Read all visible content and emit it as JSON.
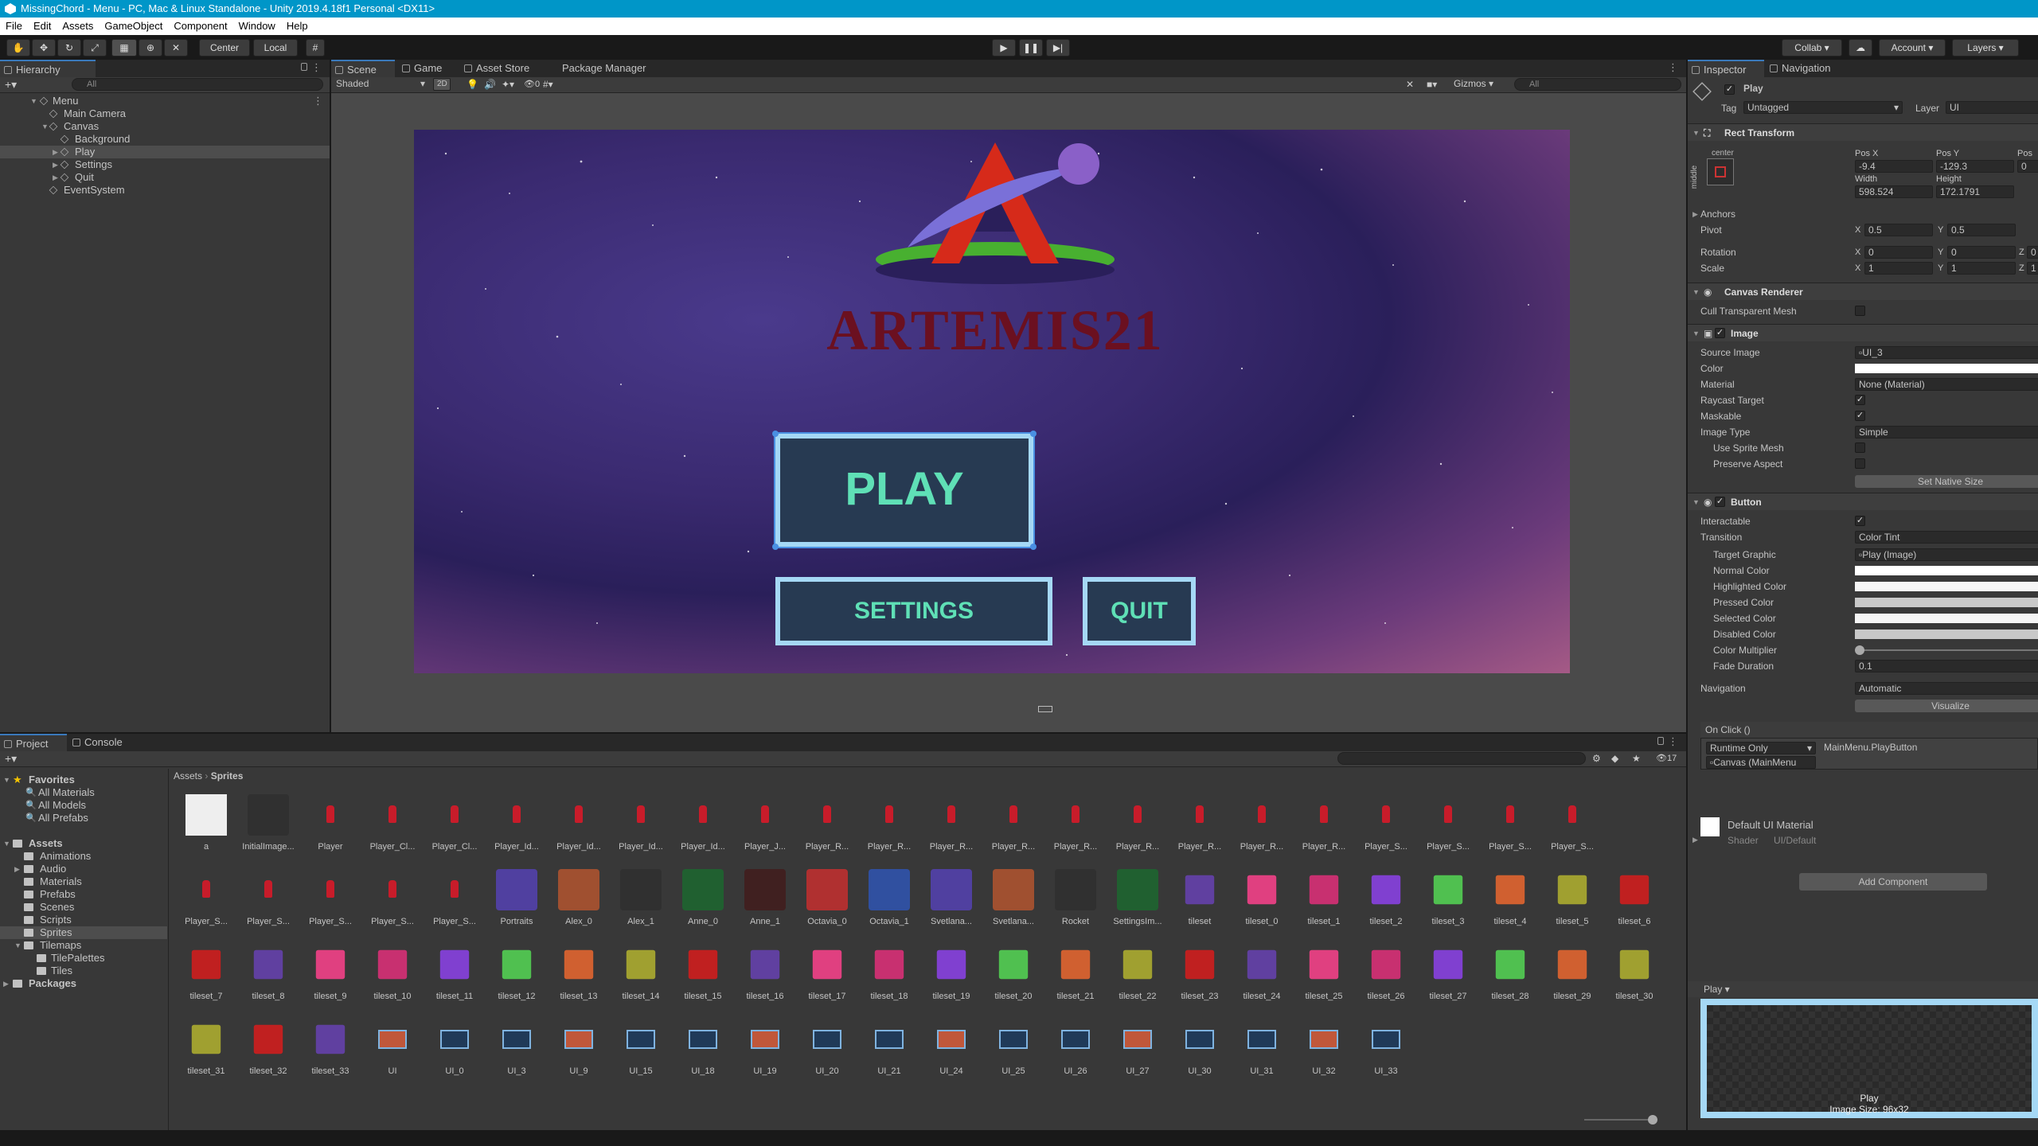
{
  "window": {
    "title": "MissingChord - Menu - PC, Mac & Linux Standalone - Unity 2019.4.18f1 Personal <DX11>"
  },
  "menubar": {
    "items": [
      "File",
      "Edit",
      "Assets",
      "GameObject",
      "Component",
      "Window",
      "Help"
    ]
  },
  "toolbar": {
    "pivot": "Center",
    "space": "Local",
    "collab": "Collab",
    "account": "Account",
    "layers": "Layers"
  },
  "hierarchy": {
    "tab": "Hierarchy",
    "search": "All",
    "items": [
      {
        "label": "Menu",
        "depth": 0,
        "selected": false
      },
      {
        "label": "Main Camera",
        "depth": 1,
        "selected": false
      },
      {
        "label": "Canvas",
        "depth": 1,
        "selected": false
      },
      {
        "label": "Background",
        "depth": 2,
        "selected": false
      },
      {
        "label": "Play",
        "depth": 2,
        "selected": true
      },
      {
        "label": "Settings",
        "depth": 2,
        "selected": false
      },
      {
        "label": "Quit",
        "depth": 2,
        "selected": false
      },
      {
        "label": "EventSystem",
        "depth": 1,
        "selected": false
      }
    ]
  },
  "scene": {
    "tabs": [
      "Scene",
      "Game",
      "Asset Store",
      "Package Manager"
    ],
    "shading": "Shaded",
    "mode2d": "2D",
    "fx_count": "0",
    "gizmos": "Gizmos",
    "search": "All"
  },
  "game": {
    "logo": "ARTEMIS21",
    "play": "PLAY",
    "settings": "SETTINGS",
    "quit": "QUIT"
  },
  "project": {
    "tabs": [
      "Project",
      "Console"
    ],
    "favorites_title": "Favorites",
    "favorites": [
      "All Materials",
      "All Models",
      "All Prefabs"
    ],
    "assets_title": "Assets",
    "folders": [
      {
        "label": "Animations",
        "depth": 1
      },
      {
        "label": "Audio",
        "depth": 1
      },
      {
        "label": "Materials",
        "depth": 1
      },
      {
        "label": "Prefabs",
        "depth": 1
      },
      {
        "label": "Scenes",
        "depth": 1
      },
      {
        "label": "Scripts",
        "depth": 1
      },
      {
        "label": "Sprites",
        "depth": 1
      },
      {
        "label": "Tilemaps",
        "depth": 1
      },
      {
        "label": "TilePalettes",
        "depth": 2
      },
      {
        "label": "Tiles",
        "depth": 2
      }
    ],
    "packages": "Packages",
    "breadcrumb": [
      "Assets",
      "Sprites"
    ],
    "hidden_count": "17",
    "rows": [
      [
        "a",
        "InitialImage...",
        "Player",
        "Player_Cl...",
        "Player_Cl...",
        "Player_Id...",
        "Player_Id...",
        "Player_Id...",
        "Player_Id...",
        "Player_J...",
        "Player_R...",
        "Player_R...",
        "Player_R...",
        "Player_R...",
        "Player_R...",
        "Player_R...",
        "Player_R...",
        "Player_R...",
        "Player_R...",
        "Player_S...",
        "Player_S...",
        "Player_S...",
        "Player_S..."
      ],
      [
        "Player_S...",
        "Player_S...",
        "Player_S...",
        "Player_S...",
        "Player_S...",
        "Portraits",
        "Alex_0",
        "Alex_1",
        "Anne_0",
        "Anne_1",
        "Octavia_0",
        "Octavia_1",
        "Svetlana...",
        "Svetlana...",
        "Rocket",
        "SettingsIm...",
        "tileset",
        "tileset_0",
        "tileset_1",
        "tileset_2",
        "tileset_3",
        "tileset_4",
        "tileset_5",
        "tileset_6"
      ],
      [
        "tileset_7",
        "tileset_8",
        "tileset_9",
        "tileset_10",
        "tileset_11",
        "tileset_12",
        "tileset_13",
        "tileset_14",
        "tileset_15",
        "tileset_16",
        "tileset_17",
        "tileset_18",
        "tileset_19",
        "tileset_20",
        "tileset_21",
        "tileset_22",
        "tileset_23",
        "tileset_24",
        "tileset_25",
        "tileset_26",
        "tileset_27",
        "tileset_28",
        "tileset_29",
        "tileset_30"
      ],
      [
        "tileset_31",
        "tileset_32",
        "tileset_33",
        "UI",
        "UI_0",
        "UI_3",
        "UI_9",
        "UI_15",
        "UI_18",
        "UI_19",
        "UI_20",
        "UI_21",
        "UI_24",
        "UI_25",
        "UI_26",
        "UI_27",
        "UI_30",
        "UI_31",
        "UI_32",
        "UI_33"
      ]
    ]
  },
  "inspector": {
    "tabs": [
      "Inspector",
      "Navigation"
    ],
    "object_name": "Play",
    "tag_label": "Tag",
    "tag": "Untagged",
    "layer_label": "Layer",
    "layer": "UI",
    "rect": {
      "title": "Rect Transform",
      "anchor_h": "center",
      "anchor_v": "middle",
      "posx_label": "Pos X",
      "posy_label": "Pos Y",
      "posz_label": "Pos",
      "posx": "-9.4",
      "posy": "-129.3",
      "posz": "0",
      "width_label": "Width",
      "height_label": "Height",
      "width": "598.524",
      "height": "172.1791",
      "anchors": "Anchors",
      "pivot": "Pivot",
      "pivot_x": "0.5",
      "pivot_y": "0.5",
      "rotation": "Rotation",
      "rot_x": "0",
      "rot_y": "0",
      "rot_z": "0",
      "scale": "Scale",
      "sc_x": "1",
      "sc_y": "1",
      "sc_z": "1",
      "x": "X",
      "y": "Y",
      "z": "Z"
    },
    "canvas_renderer": {
      "title": "Canvas Renderer",
      "cull": "Cull Transparent Mesh"
    },
    "image": {
      "title": "Image",
      "source_label": "Source Image",
      "source": "UI_3",
      "color_label": "Color",
      "material_label": "Material",
      "material": "None (Material)",
      "raycast": "Raycast Target",
      "maskable": "Maskable",
      "type_label": "Image Type",
      "type": "Simple",
      "sprite_mesh": "Use Sprite Mesh",
      "preserve": "Preserve Aspect",
      "native": "Set Native Size"
    },
    "button": {
      "title": "Button",
      "interactable": "Interactable",
      "transition_label": "Transition",
      "transition": "Color Tint",
      "target_label": "Target Graphic",
      "target": "Play (Image)",
      "normal": "Normal Color",
      "highlighted": "Highlighted Color",
      "pressed": "Pressed Color",
      "selected": "Selected Color",
      "disabled": "Disabled Color",
      "multiplier": "Color Multiplier",
      "fade_label": "Fade Duration",
      "fade": "0.1",
      "nav_label": "Navigation",
      "nav": "Automatic",
      "visualize": "Visualize",
      "onclick": "On Click ()",
      "runtime": "Runtime Only",
      "func": "MainMenu.PlayButton",
      "obj": "Canvas (MainMenu"
    },
    "material": {
      "name": "Default UI Material",
      "shader_label": "Shader",
      "shader": "UI/Default"
    },
    "add_component": "Add Component",
    "preview": {
      "title": "Play",
      "name": "Play",
      "size": "Image Size: 96x32"
    }
  },
  "colors": {
    "accent": "#0096c8",
    "play_text": "#5fe0b6",
    "button_border": "#a5d8f5",
    "logo_text": "#6b1020"
  }
}
